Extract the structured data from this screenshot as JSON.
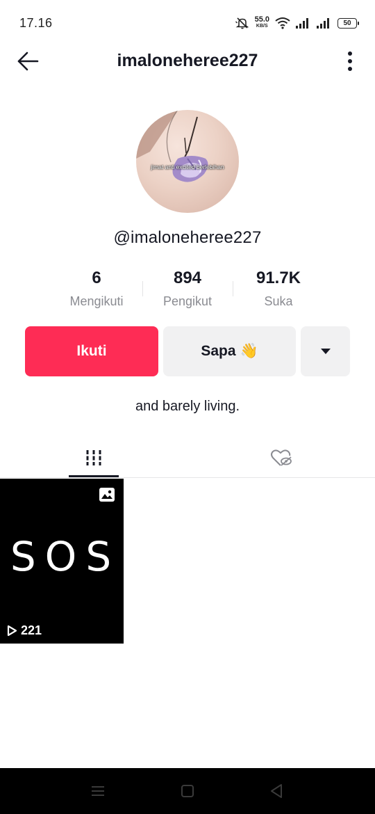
{
  "status_bar": {
    "time": "17.16",
    "net_speed_value": "55.0",
    "net_speed_unit": "KB/S",
    "battery": "50",
    "icons": [
      "mute-bell-icon",
      "wifi-icon",
      "signal-icon",
      "signal-icon",
      "battery-icon"
    ]
  },
  "header": {
    "title": "imaloneheree227"
  },
  "profile": {
    "avatar_caption": "jimat anti excited berlebihan",
    "username": "@imaloneheree227",
    "bio": "and barely living."
  },
  "stats": [
    {
      "value": "6",
      "label": "Mengikuti"
    },
    {
      "value": "894",
      "label": "Pengikut"
    },
    {
      "value": "91.7K",
      "label": "Suka"
    }
  ],
  "actions": {
    "follow_label": "Ikuti",
    "sapa_label": "Sapa",
    "sapa_emoji": "👋"
  },
  "tabs": [
    {
      "name": "videos",
      "icon": "grid-icon",
      "active": true
    },
    {
      "name": "liked",
      "icon": "hidden-heart-icon",
      "active": false
    }
  ],
  "videos": [
    {
      "thumb_text": "SOS",
      "views": "221",
      "type_icon": "photo-icon"
    }
  ],
  "colors": {
    "accent": "#fe2c55",
    "text": "#161823",
    "muted": "#8a8b91",
    "button_gray": "#f1f1f2"
  }
}
